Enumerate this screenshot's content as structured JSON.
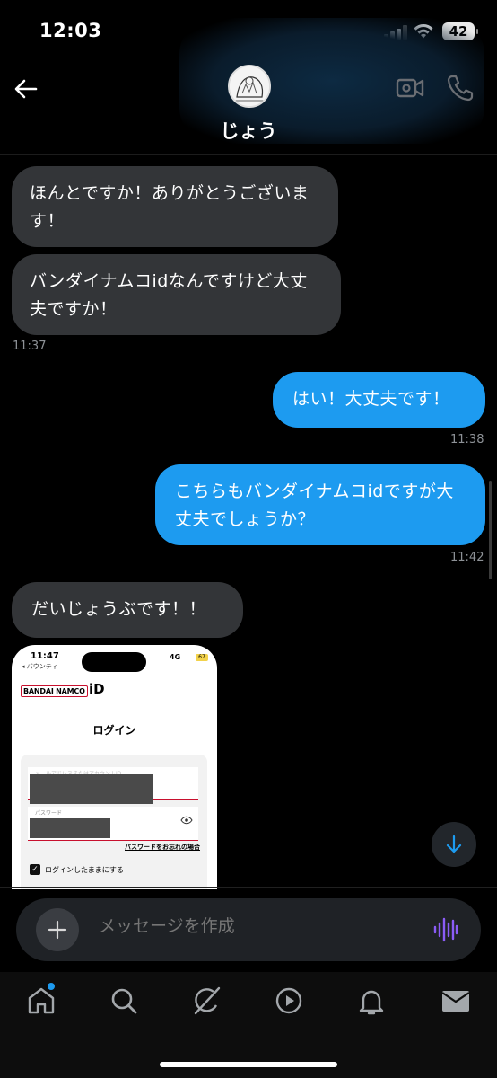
{
  "status_bar": {
    "time": "12:03",
    "battery": "42"
  },
  "header": {
    "contact_name": "じょう"
  },
  "messages": [
    {
      "text": "ほんとですか！ありがとうございます！"
    },
    {
      "text": "バンダイナムコidなんですけど大丈夫ですか！",
      "time": "11:37"
    },
    {
      "text": "はい！大丈夫です！",
      "time": "11:38"
    },
    {
      "text": "こちらもバンダイナムコidですが大丈夫でしょうか？",
      "time": "11:42"
    },
    {
      "text": "だいじょうぶです！！"
    }
  ],
  "attachment": {
    "time": "11:47",
    "back_label": "◂ バウンティ",
    "network": "4G",
    "battery": "67",
    "logo_text": "BANDAI NAMCO",
    "id_text": "iD",
    "title": "ログイン",
    "email_label": "メールアドレスまたはアカウントID",
    "password_label": "パスワード",
    "forgot_link": "パスワードをお忘れの場合",
    "remember_label": "ログインしたままにする"
  },
  "composer": {
    "placeholder": "メッセージを作成"
  },
  "colors": {
    "accent": "#1d9bf0",
    "incoming_bubble": "#333538",
    "voice_icon": "#8b5cf6"
  },
  "tabs": [
    {
      "icon": "home-icon",
      "active": true,
      "badge": true
    },
    {
      "icon": "search-icon"
    },
    {
      "icon": "grok-icon"
    },
    {
      "icon": "video-play-icon"
    },
    {
      "icon": "bell-icon"
    },
    {
      "icon": "mail-icon"
    }
  ]
}
